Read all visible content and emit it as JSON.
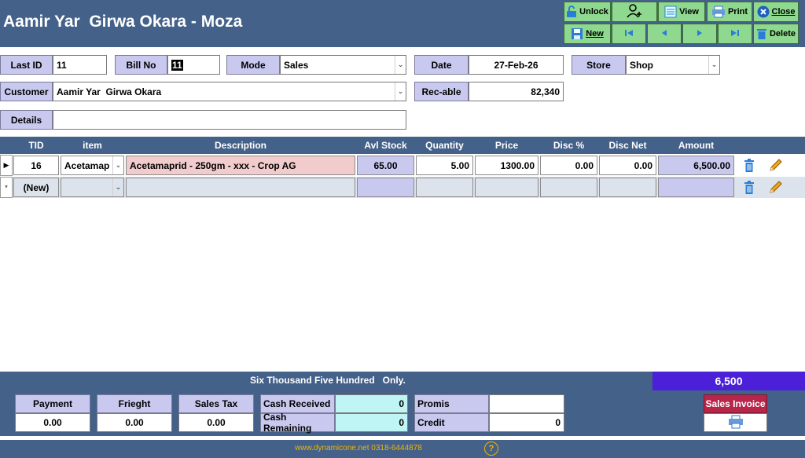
{
  "header": {
    "title": "Aamir Yar  Girwa Okara - Moza"
  },
  "toolbar": {
    "unlock": "Unlock",
    "view": "View",
    "print": "Print",
    "close": "Close",
    "new": "New",
    "delete": "Delete"
  },
  "form": {
    "last_id_label": "Last ID",
    "last_id": "11",
    "bill_no_label": "Bill No",
    "bill_no": "11",
    "mode_label": "Mode",
    "mode": "Sales",
    "date_label": "Date",
    "date": "27-Feb-26",
    "store_label": "Store",
    "store": "Shop",
    "customer_label": "Customer",
    "customer": "Aamir Yar  Girwa Okara",
    "receivable_label": "Rec-able",
    "receivable": "82,340",
    "details_label": "Details",
    "details": ""
  },
  "grid": {
    "columns": [
      "TID",
      "item",
      "Description",
      "Avl Stock",
      "Quantity",
      "Price",
      "Disc %",
      "Disc Net",
      "Amount"
    ],
    "rows": [
      {
        "tid": "16",
        "item": "Acetamap",
        "description": "Acetamaprid - 250gm - xxx - Crop AG",
        "avl_stock": "65.00",
        "quantity": "5.00",
        "price": "1300.00",
        "disc_pct": "0.00",
        "disc_net": "0.00",
        "amount": "6,500.00"
      }
    ],
    "new_row_label": "(New)"
  },
  "totals": {
    "in_words": "Six Thousand Five Hundred   Only.",
    "total": "6,500"
  },
  "summary": {
    "payment_label": "Payment",
    "payment": "0.00",
    "frieght_label": "Frieght",
    "frieght": "0.00",
    "sales_tax_label": "Sales Tax",
    "sales_tax": "0.00",
    "cash_received_label": "Cash Received",
    "cash_received": "0",
    "cash_remaining_label": "Cash Remaining",
    "cash_remaining": "0",
    "promis_label": "Promis",
    "promis": "",
    "credit_label": "Credit",
    "credit": "0",
    "sales_invoice_label": "Sales Invoice"
  },
  "status": {
    "text": "www.dynamicone.net 0318-6444878"
  },
  "colors": {
    "header_bg": "#44618a",
    "toolbar_btn": "#8fd88f",
    "label_bg": "#c9c9f0",
    "total_bg": "#4b20d8",
    "sales_invoice_bg": "#b9254a",
    "status_text": "#f0b400"
  }
}
